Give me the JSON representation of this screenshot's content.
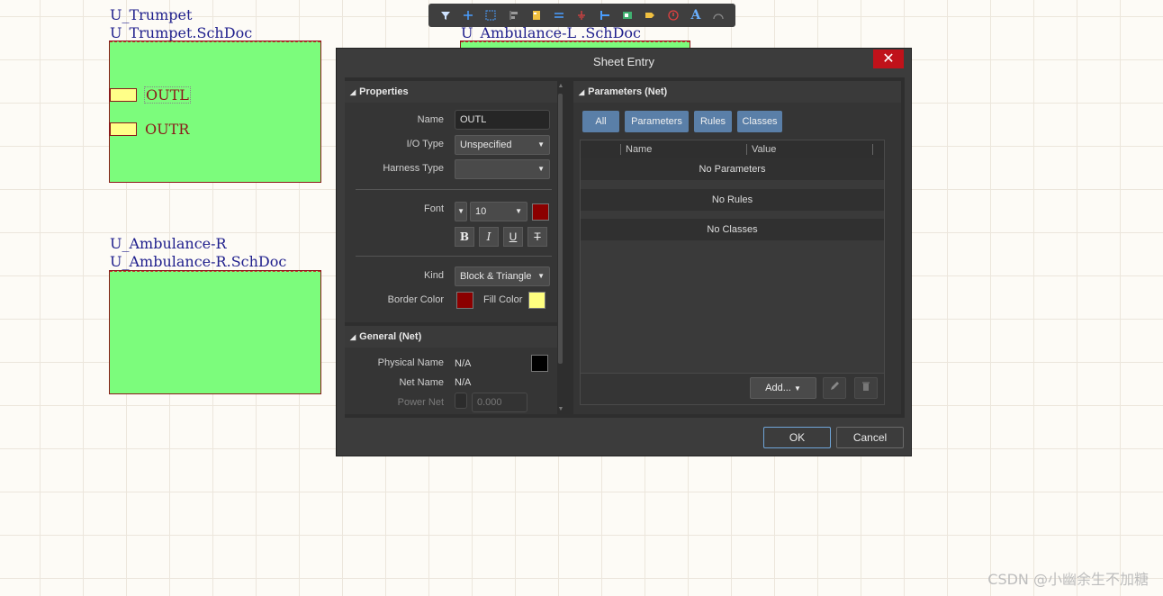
{
  "schematic": {
    "trumpet": {
      "designator": "U_Trumpet",
      "filename": "U_Trumpet.SchDoc",
      "entries": [
        "OUTL",
        "OUTR"
      ]
    },
    "ambulance_l": {
      "label": "U_Ambulance-L .SchDoc"
    },
    "ambulance_r": {
      "designator": "U_Ambulance-R",
      "filename": "U_Ambulance-R.SchDoc"
    }
  },
  "toolbar": {
    "icons": [
      "filter-icon",
      "cross-icon",
      "select-rect-icon",
      "align-icon",
      "sheet-symbol-icon",
      "wire-icon",
      "ground-icon",
      "bus-icon",
      "port-icon",
      "net-label-icon",
      "error-icon",
      "text-icon",
      "arc-icon"
    ],
    "text_icon_glyph": "A"
  },
  "dialog": {
    "title": "Sheet Entry",
    "close_glyph": "✕",
    "properties": {
      "header": "Properties",
      "name_label": "Name",
      "name_value": "OUTL",
      "io_type_label": "I/O Type",
      "io_type_value": "Unspecified",
      "harness_type_label": "Harness Type",
      "harness_type_value": "",
      "font_label": "Font",
      "font_size": "10",
      "font_color": "#8b0000",
      "fmt": {
        "bold": "B",
        "italic": "I",
        "underline": "U",
        "strike": "T"
      },
      "kind_label": "Kind",
      "kind_value": "Block & Triangle",
      "border_color_label": "Border Color",
      "border_color": "#8b0000",
      "fill_color_label": "Fill Color",
      "fill_color": "#ffff80"
    },
    "general": {
      "header": "General (Net)",
      "physical_name_label": "Physical Name",
      "physical_name_value": "N/A",
      "net_name_label": "Net Name",
      "net_name_value": "N/A",
      "power_net_label": "Power Net",
      "power_net_value": "0.000",
      "swatch_color": "#000000"
    },
    "parameters": {
      "header": "Parameters (Net)",
      "filters": [
        "All",
        "Parameters",
        "Rules",
        "Classes"
      ],
      "columns": [
        "Name",
        "Value"
      ],
      "rows": [
        "No Parameters",
        "No Rules",
        "No Classes"
      ],
      "add_label": "Add...",
      "edit_icon": "pencil-icon",
      "delete_icon": "trash-icon"
    },
    "ok_label": "OK",
    "cancel_label": "Cancel"
  },
  "watermark": "CSDN @小幽余生不加糖"
}
